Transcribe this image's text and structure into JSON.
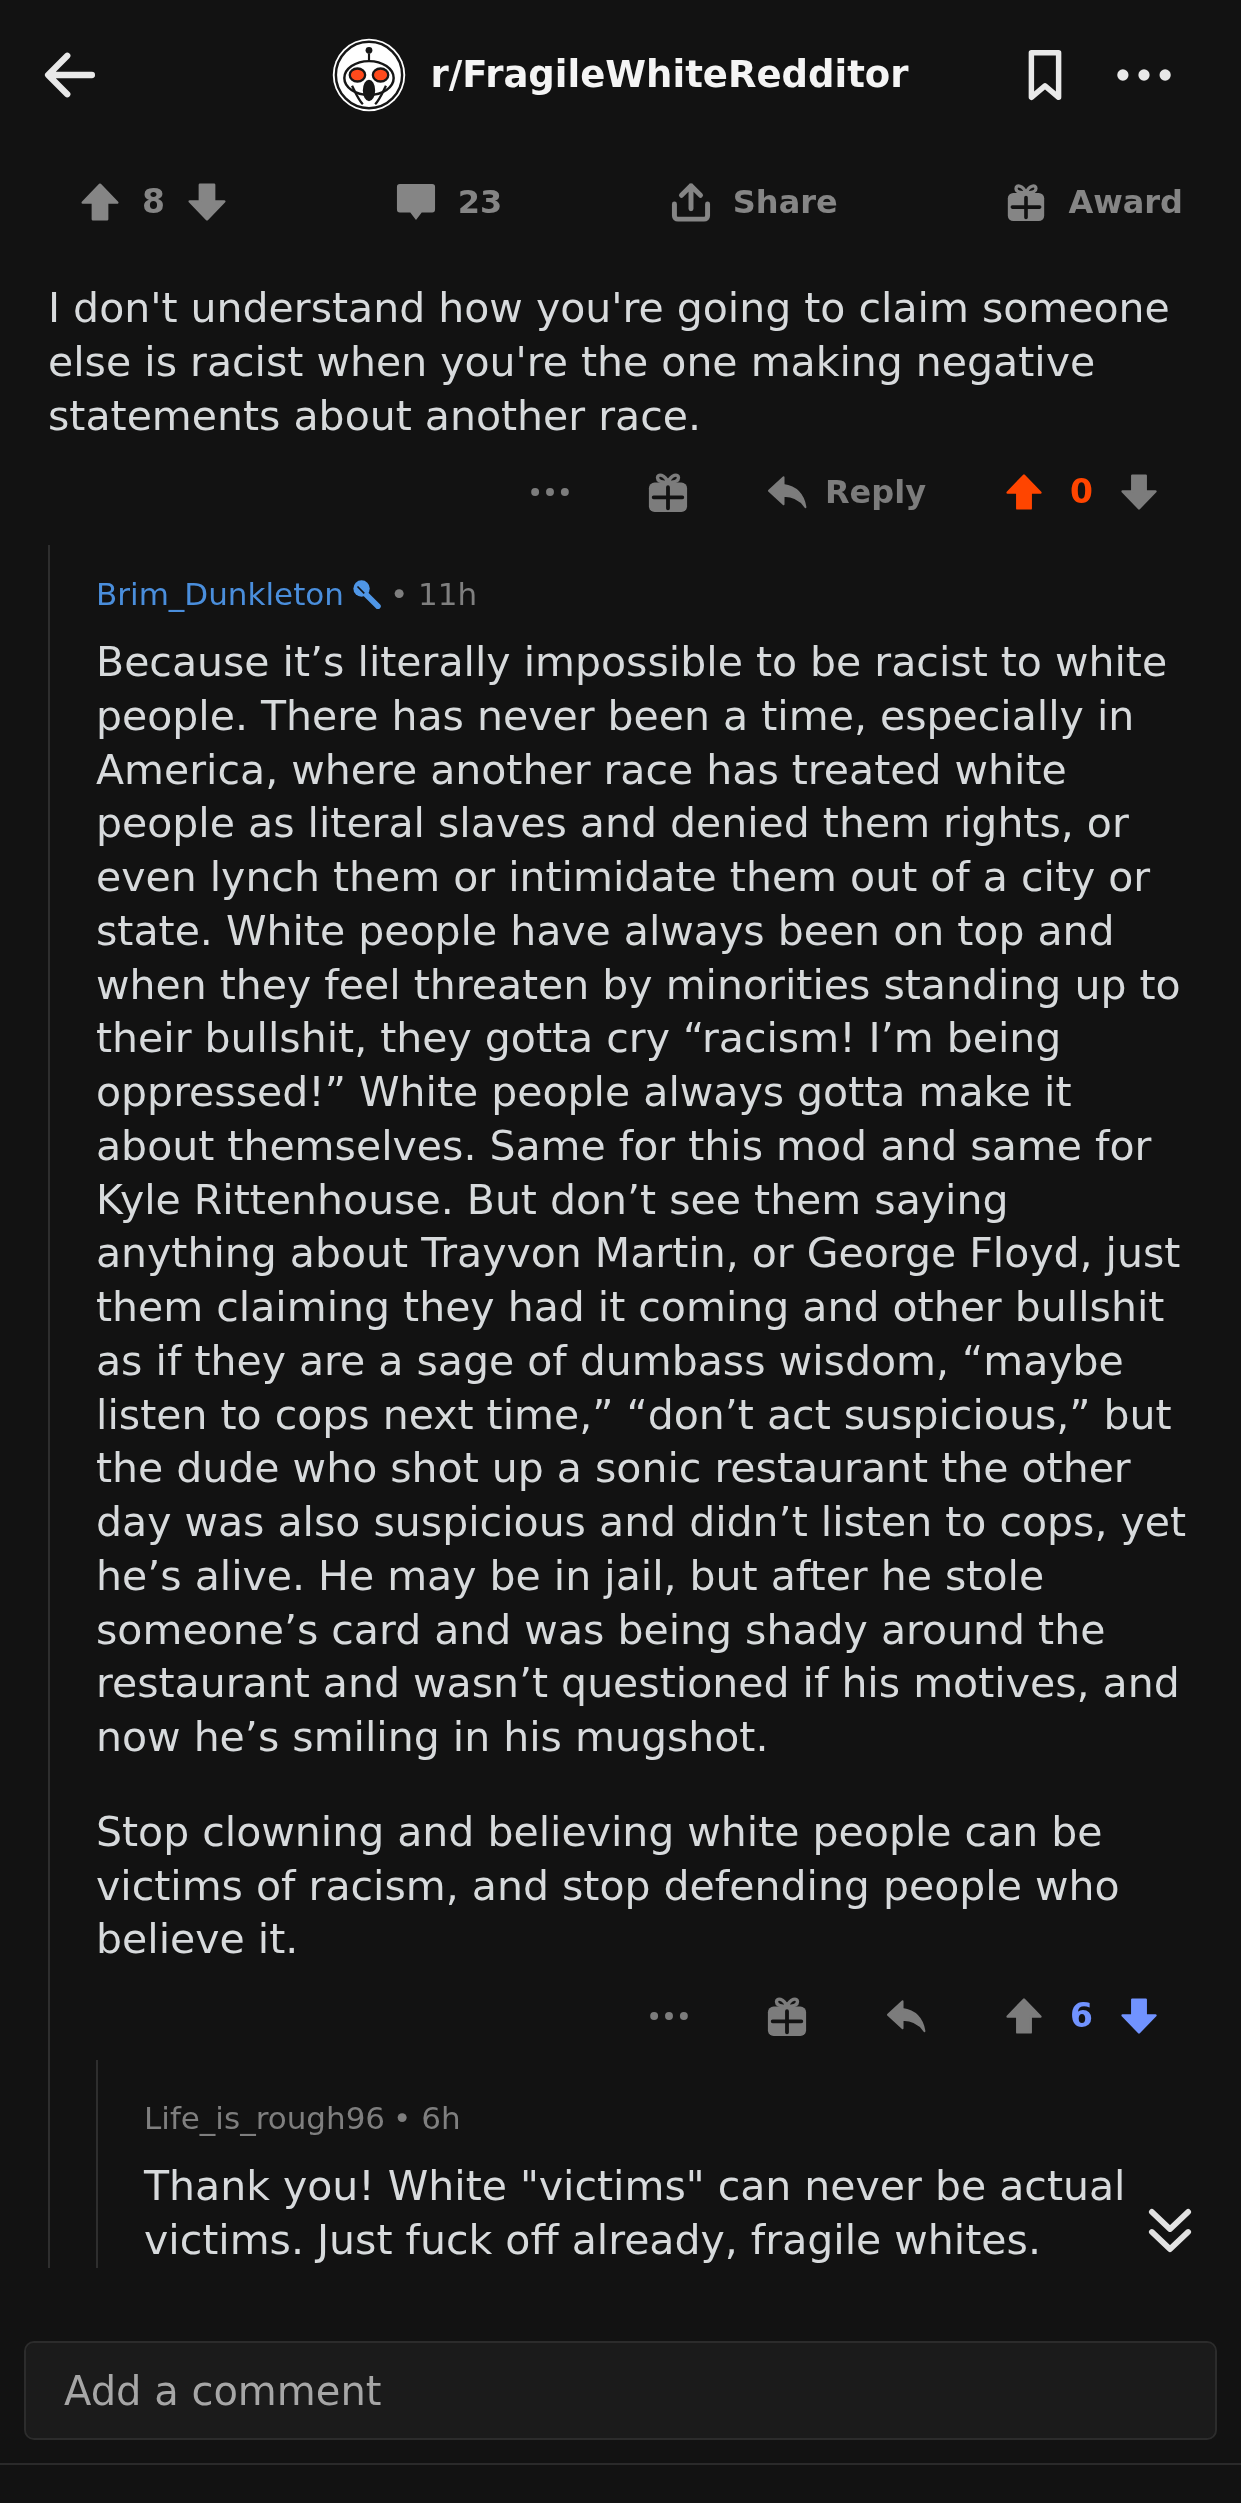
{
  "header": {
    "subreddit": "r/FragileWhiteRedditor"
  },
  "post_actions": {
    "score": "8",
    "upvoted": false,
    "downvoted": false,
    "comments": "23",
    "share": "Share",
    "award": "Award"
  },
  "comments": [
    {
      "body": [
        "I don't understand how you're going to claim someone else is racist when you're the one making negative statements about another race."
      ],
      "actions": {
        "reply_label": "Reply",
        "score": "0",
        "upvoted": true,
        "downvoted": false
      },
      "replies": [
        {
          "author": "Brim_Dunkleton",
          "author_highlighted": true,
          "badge": true,
          "meta": "• 11h",
          "body": [
            "Because it’s literally impossible to be racist to white people. There has never been a time, especially in America, where another race has treated white people as literal slaves and denied them rights, or even lynch them or intimidate them out of a city or state. White people have always been on top and when they feel threaten by minorities standing up to their bullshit, they gotta cry “racism! I’m being oppressed!” White people always gotta make it about themselves. Same for this mod and same for Kyle Rittenhouse. But don’t see them saying anything about Trayvon Martin, or George Floyd, just them claiming they had it coming and other bullshit as if they are a sage of dumbass wisdom, “maybe listen to cops next time,” “don’t act suspicious,” but the dude who shot up a sonic restaurant the other day was also suspicious and didn’t listen to cops, yet he’s alive. He may be in jail, but after he stole someone’s card and was being shady around the restaurant and wasn’t questioned if his motives, and now he’s smiling in his mugshot.",
            "Stop clowning and believing white people can be victims of racism, and stop defending people who believe it."
          ],
          "actions": {
            "score": "6",
            "upvoted": false,
            "downvoted": true
          },
          "replies": [
            {
              "author": "Life_is_rough96",
              "author_highlighted": false,
              "badge": false,
              "meta": "• 6h",
              "body": [
                "Thank you! White \"victims\" can never be actual victims. Just fuck off already, fragile whites."
              ]
            }
          ]
        }
      ]
    }
  ],
  "composer": {
    "placeholder": "Add a comment"
  }
}
